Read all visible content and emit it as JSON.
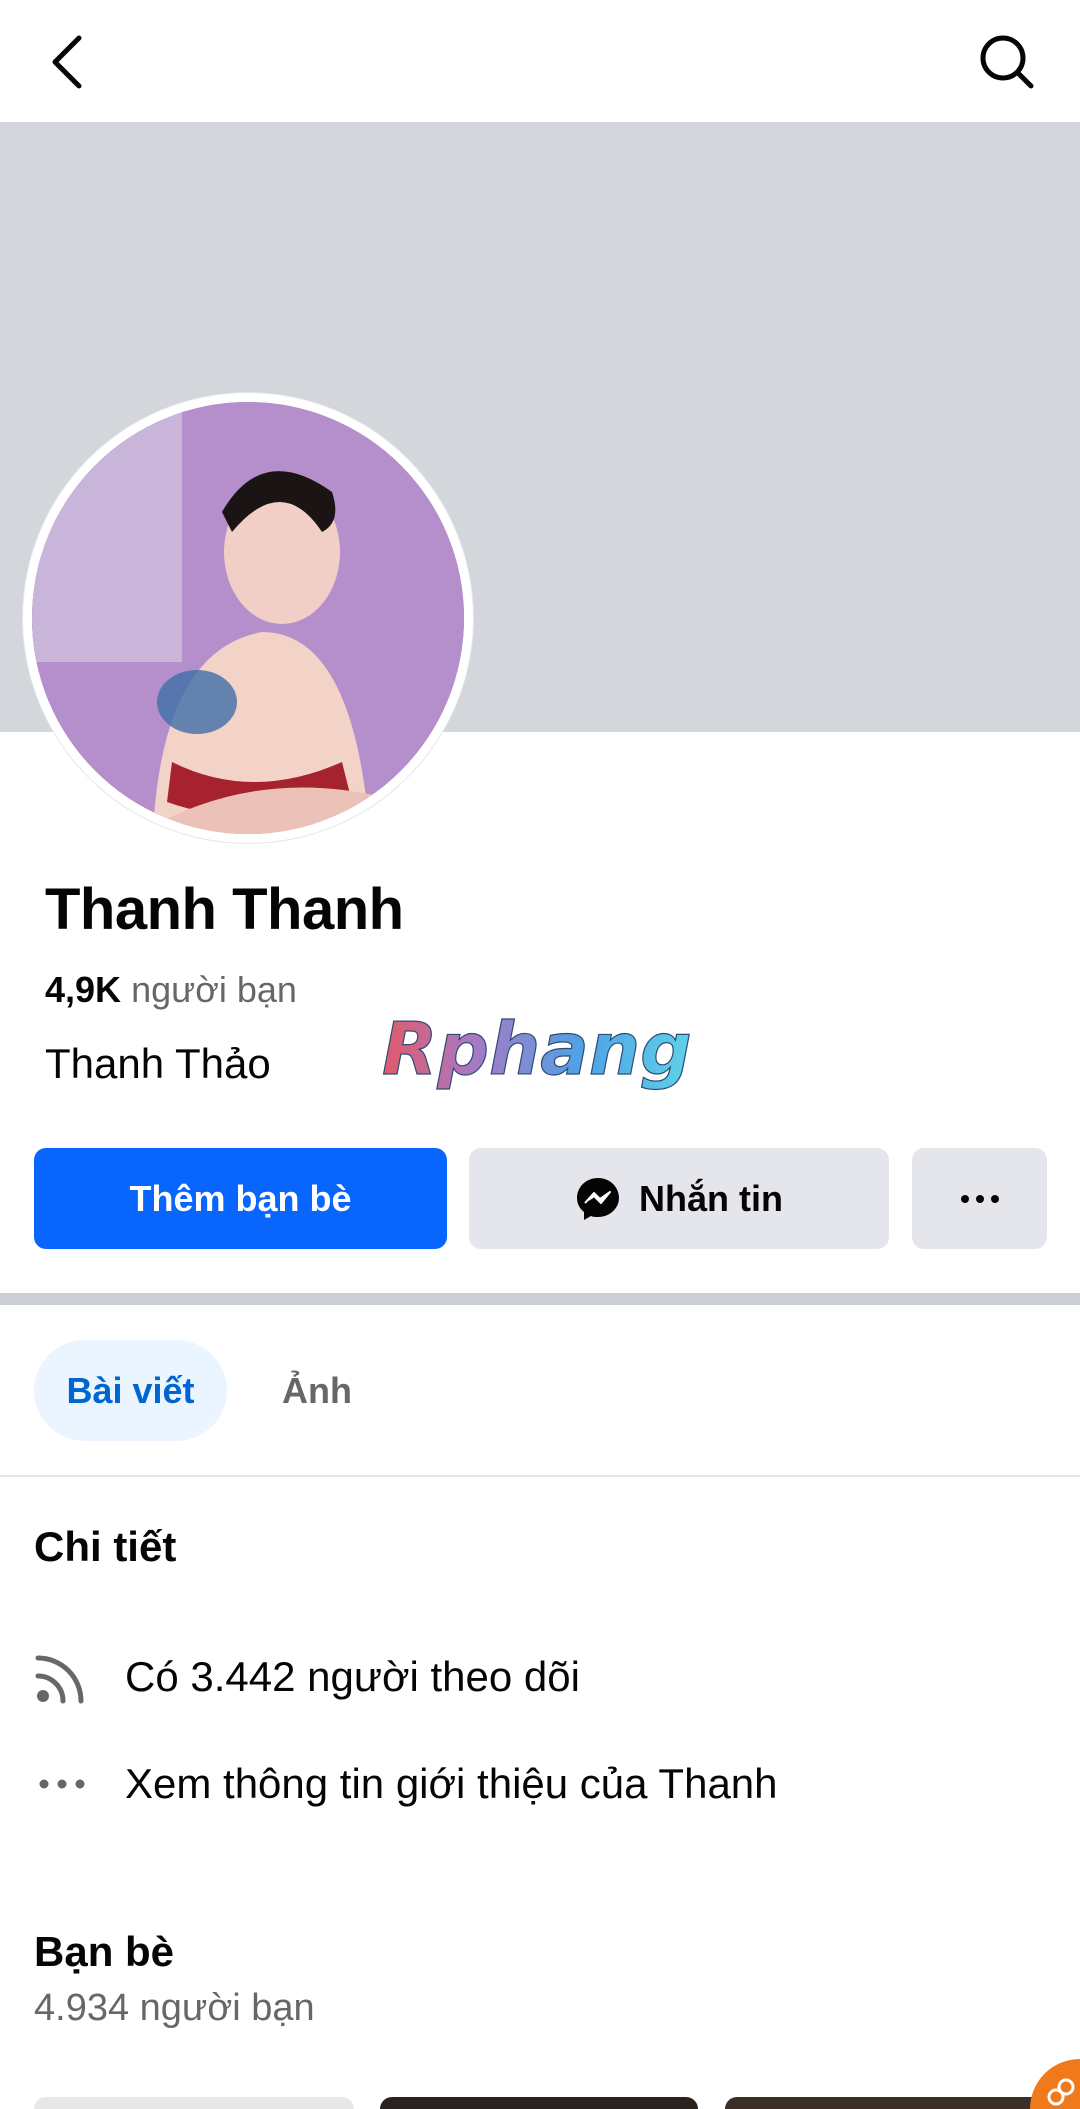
{
  "profile": {
    "name": "Thanh Thanh",
    "friends_count": "4,9K",
    "friends_label": "người bạn",
    "alt_name": "Thanh Thảo",
    "watermark": "Rphang"
  },
  "actions": {
    "add_friend": "Thêm bạn bè",
    "message": "Nhắn tin",
    "more": "···"
  },
  "tabs": [
    {
      "label": "Bài viết",
      "active": true
    },
    {
      "label": "Ảnh",
      "active": false
    }
  ],
  "details": {
    "title": "Chi tiết",
    "followers": "Có 3.442 người theo dõi",
    "about": "Xem thông tin giới thiệu của Thanh"
  },
  "friends_section": {
    "title": "Bạn bè",
    "count": "4.934 người bạn"
  },
  "icons": {
    "back": "back-arrow-icon",
    "search": "search-icon",
    "messenger": "messenger-icon",
    "rss": "rss-feed-icon",
    "dots": "more-dots-icon"
  },
  "colors": {
    "primary": "#0866ff",
    "button_secondary": "#e4e6eb",
    "cover": "#d3d6db",
    "tab_active_bg": "#ebf5ff",
    "tab_active_text": "#0064d1",
    "secondary_text": "#65676b"
  }
}
